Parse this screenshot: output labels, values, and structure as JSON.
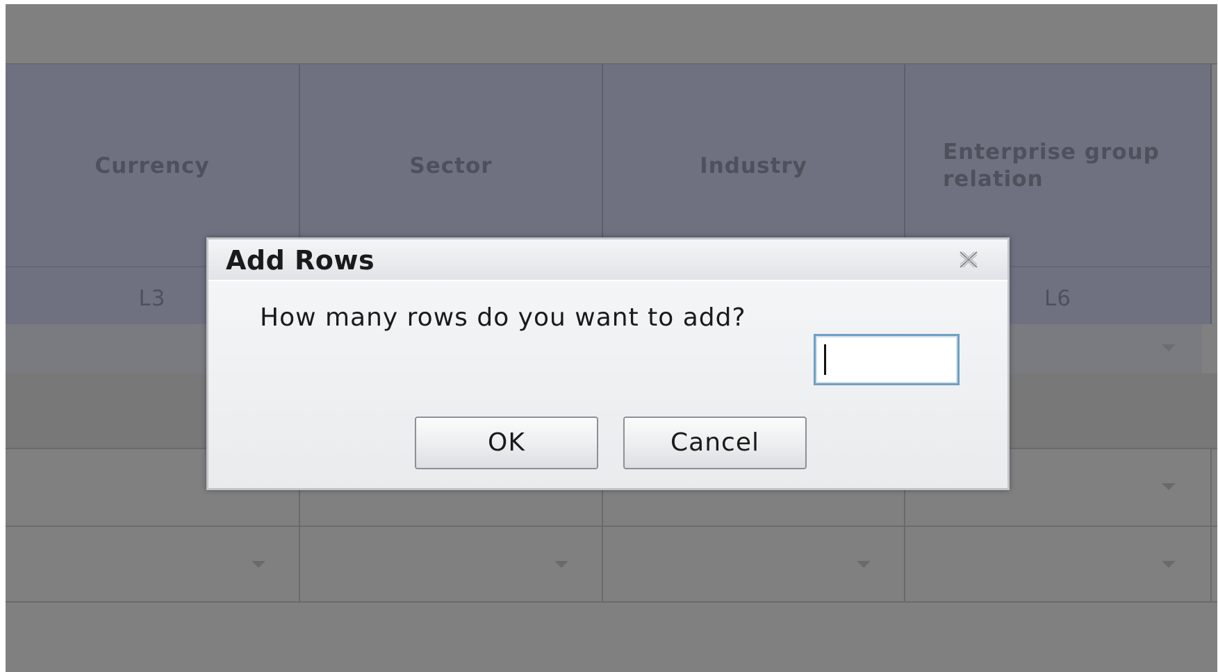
{
  "table": {
    "columns": [
      {
        "header": "Currency",
        "level": "L3"
      },
      {
        "header": "Sector",
        "level": ""
      },
      {
        "header": "Industry",
        "level": ""
      },
      {
        "header": "Enterprise group relation",
        "level": "L6"
      }
    ]
  },
  "dialog": {
    "title": "Add Rows",
    "prompt": "How many rows do you want to add?",
    "input_value": "",
    "ok_label": "OK",
    "cancel_label": "Cancel",
    "close_icon": "close-icon"
  },
  "colors": {
    "mask": "#808080",
    "header": "#6f7180",
    "dialog_bg": "#eaecee",
    "input_border": "#6f9fc0"
  }
}
